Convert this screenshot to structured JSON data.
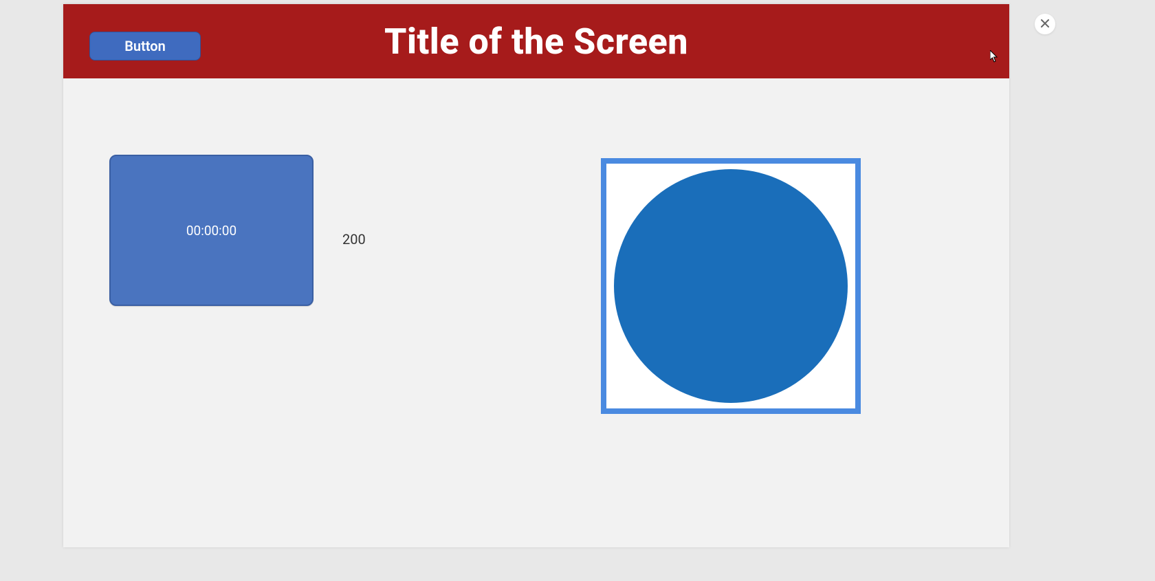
{
  "header": {
    "title": "Title of the Screen",
    "button_label": "Button"
  },
  "content": {
    "timer_value": "00:00:00",
    "number_value": "200"
  },
  "colors": {
    "header_bg": "#a61b1b",
    "button_bg": "#3f6bbf",
    "timer_bg": "#4a74bf",
    "circle_border": "#4a8ae0",
    "circle_fill": "#1a6eba"
  }
}
